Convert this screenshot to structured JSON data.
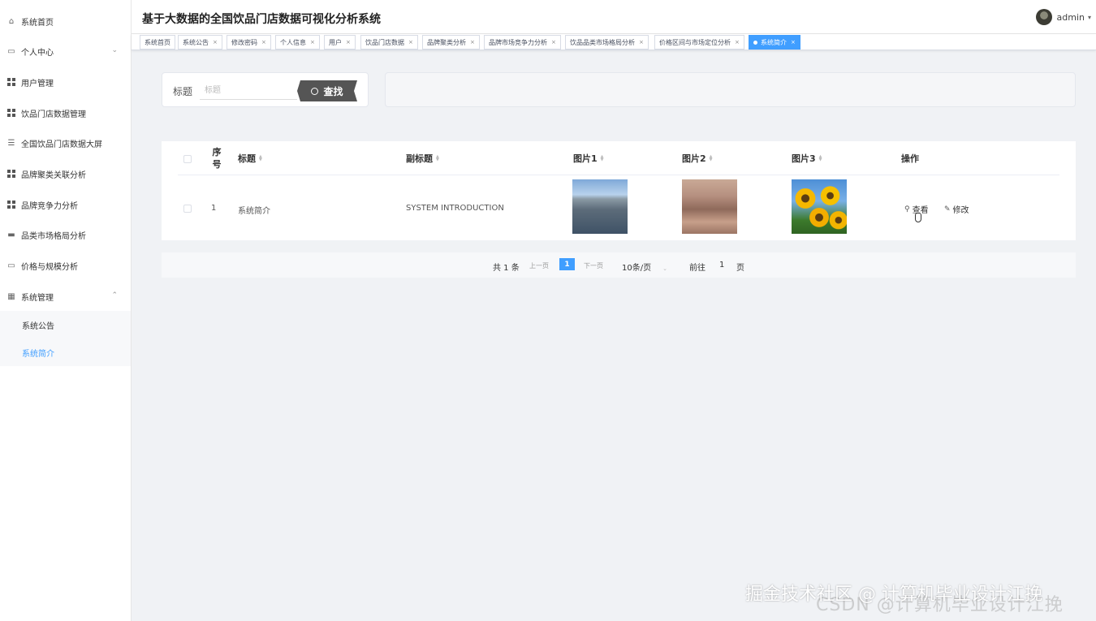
{
  "app_title": "基于大数据的全国饮品门店数据可视化分析系统",
  "user": {
    "name": "admin"
  },
  "sidebar": {
    "items": [
      {
        "label": "系统首页",
        "icon": "home-icon"
      },
      {
        "label": "个人中心",
        "icon": "profile-icon"
      },
      {
        "label": "用户管理",
        "icon": "grid-icon"
      },
      {
        "label": "饮品门店数据管理",
        "icon": "grid-icon"
      },
      {
        "label": "全国饮品门店数据大屏",
        "icon": "list-icon"
      },
      {
        "label": "品牌聚类关联分析",
        "icon": "grid-icon"
      },
      {
        "label": "品牌竞争力分析",
        "icon": "grid-icon"
      },
      {
        "label": "品类市场格局分析",
        "icon": "chat-icon"
      },
      {
        "label": "价格与规模分析",
        "icon": "monitor-icon"
      },
      {
        "label": "系统管理",
        "icon": "settings-icon"
      }
    ],
    "sub_items": [
      {
        "label": "系统公告"
      },
      {
        "label": "系统简介"
      }
    ]
  },
  "tabs": [
    {
      "label": "系统首页"
    },
    {
      "label": "系统公告"
    },
    {
      "label": "修改密码"
    },
    {
      "label": "个人信息"
    },
    {
      "label": "用户"
    },
    {
      "label": "饮品门店数据"
    },
    {
      "label": "品牌聚类分析"
    },
    {
      "label": "品牌市场竞争力分析"
    },
    {
      "label": "饮品品类市场格局分析"
    },
    {
      "label": "价格区间与市场定位分析"
    },
    {
      "label": "系统简介"
    }
  ],
  "search": {
    "label": "标题",
    "placeholder": "标题",
    "button": "查找"
  },
  "table": {
    "headers": {
      "index": "序号",
      "title": "标题",
      "subtitle": "副标题",
      "img1": "图片1",
      "img2": "图片2",
      "img3": "图片3",
      "actions": "操作"
    },
    "rows": [
      {
        "index": "1",
        "title": "系统简介",
        "subtitle": "SYSTEM INTRODUCTION",
        "view": "查看",
        "edit": "修改"
      }
    ]
  },
  "pagination": {
    "total": "共 1 条",
    "prev": "上一页",
    "page": "1",
    "next": "下一页",
    "page_size": "10条/页",
    "goto_label": "前往",
    "goto_value": "1",
    "goto_suffix": "页"
  },
  "watermark": {
    "line1": "掘金技术社区 @ 计算机毕业设计江挽",
    "line2": "CSDN @计算机毕业设计江挽"
  },
  "colors": {
    "accent": "#409eff",
    "sidebar_bg": "#ffffff",
    "content_bg": "#f0f2f5",
    "search_button": "#555555"
  }
}
